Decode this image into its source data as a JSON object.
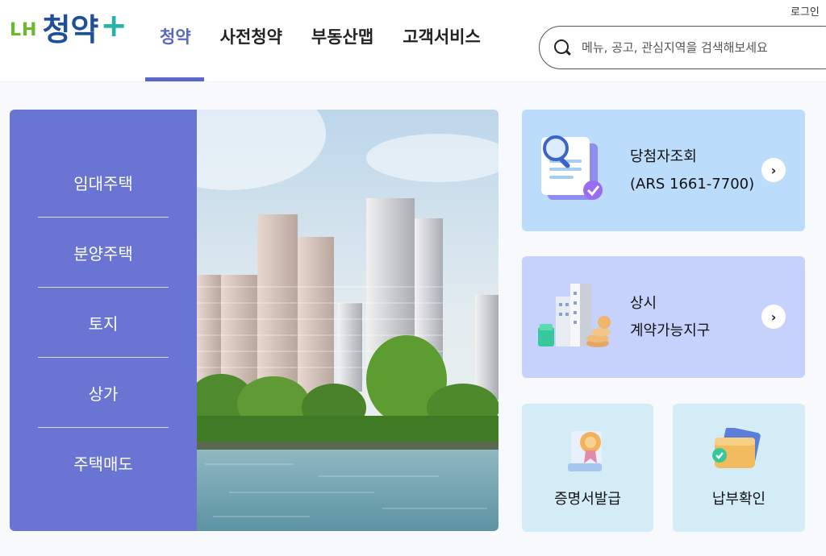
{
  "header": {
    "login": "로그인",
    "logo_prefix": "LH",
    "logo_main": "청약",
    "logo_plus": "+",
    "nav": [
      "청약",
      "사전청약",
      "부동산맵",
      "고객서비스"
    ],
    "search_placeholder": "메뉴, 공고, 관심지역을 검색해보세요"
  },
  "sidebar": {
    "items": [
      "임대주택",
      "분양주택",
      "토지",
      "상가",
      "주택매도"
    ]
  },
  "cards": {
    "winner_line1": "당첨자조회",
    "winner_line2": "(ARS 1661-7700)",
    "always_line1": "상시",
    "always_line2": "계약가능지구",
    "arrow": "›",
    "cert": "증명서발급",
    "pay": "납부확인"
  },
  "colors": {
    "accent": "#5a67c9",
    "sidebar": "#6a74d2",
    "card_blue": "#bcdcfb",
    "card_violet": "#c6d2fb",
    "card_cyan": "#d3ecf6"
  },
  "icons": [
    "search-icon",
    "document-magnifier-icon",
    "buildings-coins-icon",
    "certificate-icon",
    "wallet-icon",
    "chevron-right-icon"
  ]
}
